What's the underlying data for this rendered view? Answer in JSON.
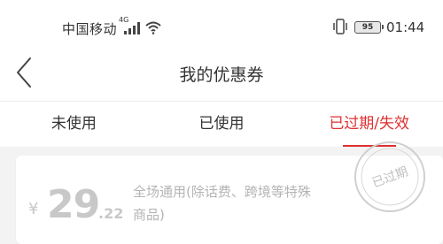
{
  "status_bar": {
    "carrier": "中国移动",
    "network": "4G",
    "battery": "95",
    "time": "01:44"
  },
  "nav": {
    "title": "我的优惠券"
  },
  "tabs": [
    {
      "label": "未使用"
    },
    {
      "label": "已使用"
    },
    {
      "label": "已过期/失效"
    }
  ],
  "active_tab_index": 2,
  "coupon": {
    "currency_symbol": "¥",
    "amount_integer": "29",
    "amount_decimal": ".22",
    "description": "全场通用(除话费、跨境等特殊商品)",
    "stamp_text": "已过期"
  },
  "colors": {
    "accent": "#e03030",
    "expired_gray": "#c8c8c8"
  },
  "icons": {
    "back": "chevron-left-icon",
    "signal": "signal-icon",
    "wifi": "wifi-icon",
    "vibrate": "vibrate-icon",
    "battery": "battery-icon"
  }
}
